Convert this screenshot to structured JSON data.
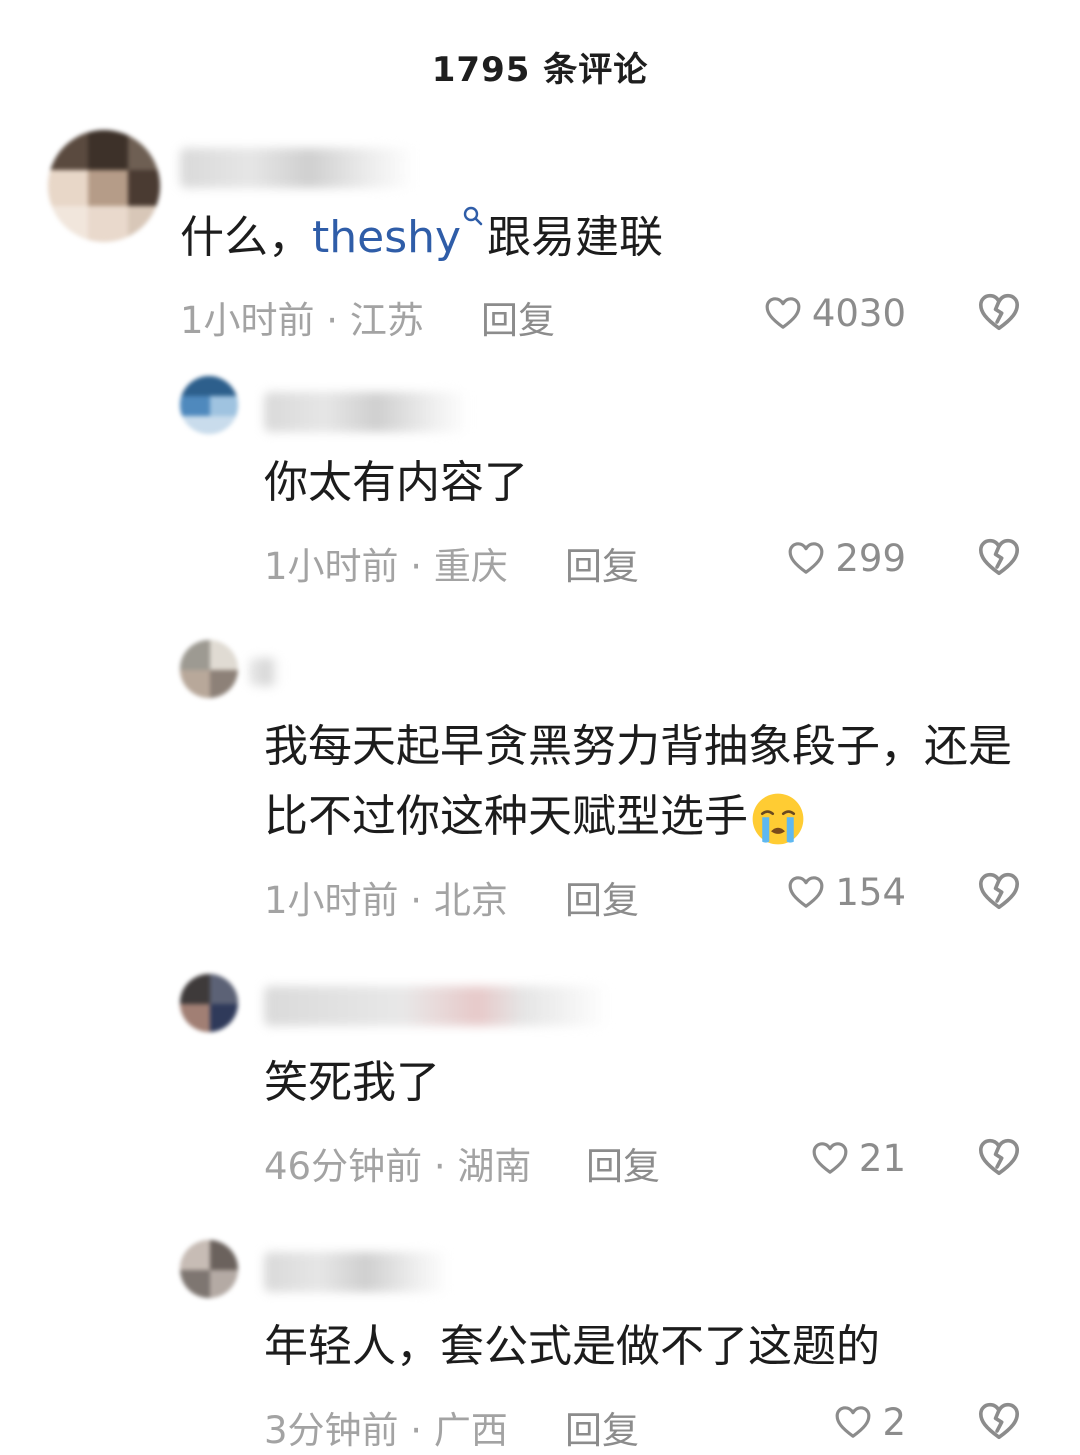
{
  "header": {
    "title": "1795 条评论"
  },
  "comments": [
    {
      "text_before": "什么，",
      "mention": "theshy",
      "text_after": "跟易建联",
      "time": "1小时前",
      "location": "江苏",
      "reply_label": "回复",
      "likes": "4030"
    },
    {
      "text": "你太有内容了",
      "time": "1小时前",
      "location": "重庆",
      "reply_label": "回复",
      "likes": "299"
    },
    {
      "text_line1": "我每天起早贪黑努力背抽象段子，还是",
      "text_line2": "比不过你这种天赋型选手",
      "emoji": "loudly-crying-face",
      "time": "1小时前",
      "location": "北京",
      "reply_label": "回复",
      "likes": "154"
    },
    {
      "text": "笑死我了",
      "time": "46分钟前",
      "location": "湖南",
      "reply_label": "回复",
      "likes": "21"
    },
    {
      "text": "年轻人，套公式是做不了这题的",
      "time": "3分钟前",
      "location": "广西",
      "reply_label": "回复",
      "likes": "2"
    }
  ],
  "separator": " · ",
  "icons": {
    "like": "heart-outline-icon",
    "dislike": "broken-heart-icon",
    "search": "search-icon"
  },
  "colors": {
    "mention": "#2f5da8",
    "meta": "#a3a3a3",
    "action": "#8c8c8c"
  }
}
